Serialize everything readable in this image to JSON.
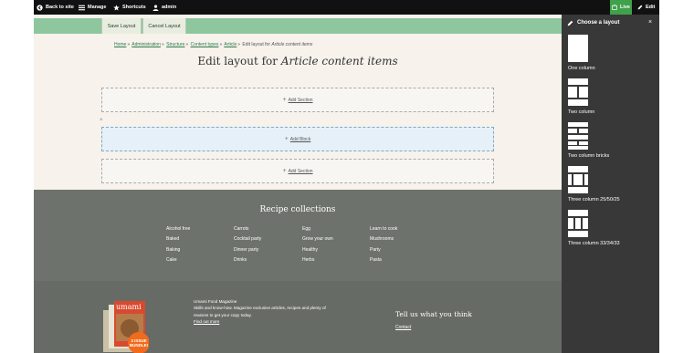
{
  "toolbar": {
    "back": "Back to site",
    "manage": "Manage",
    "shortcuts": "Shortcuts",
    "user": "admin",
    "live": "Live",
    "edit": "Edit"
  },
  "layout_builder": {
    "save_label": "Save Layout",
    "cancel_label": "Cancel Layout"
  },
  "breadcrumb": {
    "items": [
      "Home",
      "Administration",
      "Structure",
      "Content types",
      "Article"
    ],
    "current_prefix": "Edit layout for",
    "current_italic": "Article content items"
  },
  "page": {
    "title_prefix": "Edit layout for",
    "title_italic": "Article content items",
    "add_section_top": "Add Section",
    "add_block": "Add Block",
    "add_section_bottom": "Add Section",
    "close": "×"
  },
  "recipes": {
    "title": "Recipe collections",
    "columns": [
      [
        "Alcohol free",
        "Baked",
        "Baking",
        "Cake"
      ],
      [
        "Carrots",
        "Cocktail party",
        "Dinner party",
        "Drinks"
      ],
      [
        "Egg",
        "Grow your own",
        "Healthy",
        "Herbs"
      ],
      [
        "Learn to cook",
        "Mushrooms",
        "Party",
        "Pasta"
      ]
    ]
  },
  "footer": {
    "magazine_title": "Umami Food Magazine",
    "magazine_desc": "Skills and know-how. Magazine exclusive articles, recipes and plenty of reasons to get your copy today.",
    "magazine_link": "Find out more",
    "mag_brand": "umami",
    "badge_line1": "3 ISSUE",
    "badge_line2": "BUNDLE!",
    "tell_title": "Tell us what you think",
    "contact": "Contact"
  },
  "panel": {
    "title": "Choose a layout",
    "close": "×",
    "layouts": [
      "One column",
      "Two column",
      "Two column bricks",
      "Three column 25/50/25",
      "Three column 33/34/33"
    ]
  },
  "colors": {
    "toolbar": "#111111",
    "accent_green": "#3fa14a",
    "layout_bar": "#8ec69d",
    "panel": "#383838",
    "footer": "#6e726c"
  }
}
